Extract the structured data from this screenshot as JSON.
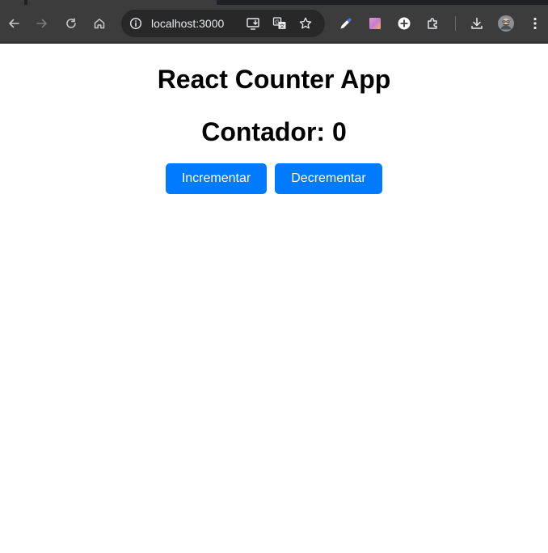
{
  "browser": {
    "url": "localhost:3000",
    "icons": {
      "back": "back-arrow-icon",
      "forward": "forward-arrow-icon",
      "reload": "reload-icon",
      "home": "home-icon",
      "site_info": "site-info-icon",
      "install_app": "install-app-icon",
      "translate": "translate-icon",
      "bookmark": "bookmark-star-icon",
      "eyedropper": "eyedropper-extension-icon",
      "colorpicker": "color-swatch-extension-icon",
      "add": "add-circle-extension-icon",
      "extensions": "extensions-puzzle-icon",
      "downloads": "download-icon",
      "profile": "profile-avatar",
      "menu": "kebab-menu-icon"
    },
    "colors": {
      "chrome_bg": "#3c3c3c",
      "omnibox_bg": "#282828",
      "icon": "#e8eaed"
    }
  },
  "app": {
    "title": "React Counter App",
    "counter_text": "Contador: 0",
    "increment_label": "Incrementar",
    "decrement_label": "Decrementar",
    "colors": {
      "button_bg": "#007bff",
      "button_text": "#ffffff",
      "text": "#000000"
    }
  }
}
